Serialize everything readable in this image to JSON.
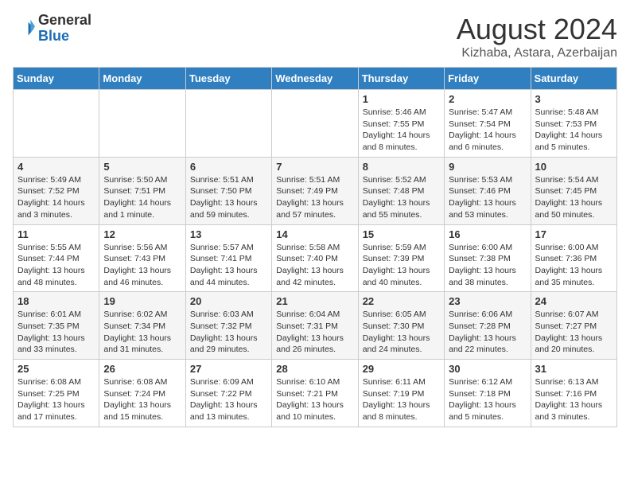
{
  "header": {
    "logo_general": "General",
    "logo_blue": "Blue",
    "month_year": "August 2024",
    "location": "Kizhaba, Astara, Azerbaijan"
  },
  "days_of_week": [
    "Sunday",
    "Monday",
    "Tuesday",
    "Wednesday",
    "Thursday",
    "Friday",
    "Saturday"
  ],
  "weeks": [
    [
      {
        "day": "",
        "info": ""
      },
      {
        "day": "",
        "info": ""
      },
      {
        "day": "",
        "info": ""
      },
      {
        "day": "",
        "info": ""
      },
      {
        "day": "1",
        "info": "Sunrise: 5:46 AM\nSunset: 7:55 PM\nDaylight: 14 hours\nand 8 minutes."
      },
      {
        "day": "2",
        "info": "Sunrise: 5:47 AM\nSunset: 7:54 PM\nDaylight: 14 hours\nand 6 minutes."
      },
      {
        "day": "3",
        "info": "Sunrise: 5:48 AM\nSunset: 7:53 PM\nDaylight: 14 hours\nand 5 minutes."
      }
    ],
    [
      {
        "day": "4",
        "info": "Sunrise: 5:49 AM\nSunset: 7:52 PM\nDaylight: 14 hours\nand 3 minutes."
      },
      {
        "day": "5",
        "info": "Sunrise: 5:50 AM\nSunset: 7:51 PM\nDaylight: 14 hours\nand 1 minute."
      },
      {
        "day": "6",
        "info": "Sunrise: 5:51 AM\nSunset: 7:50 PM\nDaylight: 13 hours\nand 59 minutes."
      },
      {
        "day": "7",
        "info": "Sunrise: 5:51 AM\nSunset: 7:49 PM\nDaylight: 13 hours\nand 57 minutes."
      },
      {
        "day": "8",
        "info": "Sunrise: 5:52 AM\nSunset: 7:48 PM\nDaylight: 13 hours\nand 55 minutes."
      },
      {
        "day": "9",
        "info": "Sunrise: 5:53 AM\nSunset: 7:46 PM\nDaylight: 13 hours\nand 53 minutes."
      },
      {
        "day": "10",
        "info": "Sunrise: 5:54 AM\nSunset: 7:45 PM\nDaylight: 13 hours\nand 50 minutes."
      }
    ],
    [
      {
        "day": "11",
        "info": "Sunrise: 5:55 AM\nSunset: 7:44 PM\nDaylight: 13 hours\nand 48 minutes."
      },
      {
        "day": "12",
        "info": "Sunrise: 5:56 AM\nSunset: 7:43 PM\nDaylight: 13 hours\nand 46 minutes."
      },
      {
        "day": "13",
        "info": "Sunrise: 5:57 AM\nSunset: 7:41 PM\nDaylight: 13 hours\nand 44 minutes."
      },
      {
        "day": "14",
        "info": "Sunrise: 5:58 AM\nSunset: 7:40 PM\nDaylight: 13 hours\nand 42 minutes."
      },
      {
        "day": "15",
        "info": "Sunrise: 5:59 AM\nSunset: 7:39 PM\nDaylight: 13 hours\nand 40 minutes."
      },
      {
        "day": "16",
        "info": "Sunrise: 6:00 AM\nSunset: 7:38 PM\nDaylight: 13 hours\nand 38 minutes."
      },
      {
        "day": "17",
        "info": "Sunrise: 6:00 AM\nSunset: 7:36 PM\nDaylight: 13 hours\nand 35 minutes."
      }
    ],
    [
      {
        "day": "18",
        "info": "Sunrise: 6:01 AM\nSunset: 7:35 PM\nDaylight: 13 hours\nand 33 minutes."
      },
      {
        "day": "19",
        "info": "Sunrise: 6:02 AM\nSunset: 7:34 PM\nDaylight: 13 hours\nand 31 minutes."
      },
      {
        "day": "20",
        "info": "Sunrise: 6:03 AM\nSunset: 7:32 PM\nDaylight: 13 hours\nand 29 minutes."
      },
      {
        "day": "21",
        "info": "Sunrise: 6:04 AM\nSunset: 7:31 PM\nDaylight: 13 hours\nand 26 minutes."
      },
      {
        "day": "22",
        "info": "Sunrise: 6:05 AM\nSunset: 7:30 PM\nDaylight: 13 hours\nand 24 minutes."
      },
      {
        "day": "23",
        "info": "Sunrise: 6:06 AM\nSunset: 7:28 PM\nDaylight: 13 hours\nand 22 minutes."
      },
      {
        "day": "24",
        "info": "Sunrise: 6:07 AM\nSunset: 7:27 PM\nDaylight: 13 hours\nand 20 minutes."
      }
    ],
    [
      {
        "day": "25",
        "info": "Sunrise: 6:08 AM\nSunset: 7:25 PM\nDaylight: 13 hours\nand 17 minutes."
      },
      {
        "day": "26",
        "info": "Sunrise: 6:08 AM\nSunset: 7:24 PM\nDaylight: 13 hours\nand 15 minutes."
      },
      {
        "day": "27",
        "info": "Sunrise: 6:09 AM\nSunset: 7:22 PM\nDaylight: 13 hours\nand 13 minutes."
      },
      {
        "day": "28",
        "info": "Sunrise: 6:10 AM\nSunset: 7:21 PM\nDaylight: 13 hours\nand 10 minutes."
      },
      {
        "day": "29",
        "info": "Sunrise: 6:11 AM\nSunset: 7:19 PM\nDaylight: 13 hours\nand 8 minutes."
      },
      {
        "day": "30",
        "info": "Sunrise: 6:12 AM\nSunset: 7:18 PM\nDaylight: 13 hours\nand 5 minutes."
      },
      {
        "day": "31",
        "info": "Sunrise: 6:13 AM\nSunset: 7:16 PM\nDaylight: 13 hours\nand 3 minutes."
      }
    ]
  ]
}
